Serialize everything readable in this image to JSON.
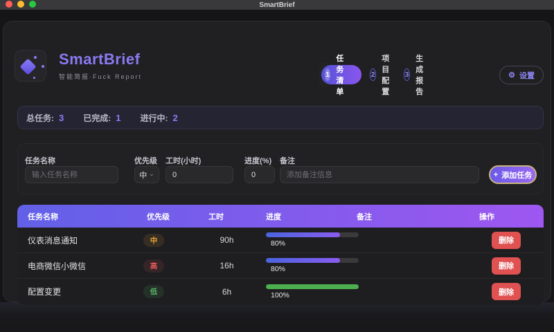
{
  "window": {
    "titlebar_title": "SmartBrief"
  },
  "header": {
    "app_title": "SmartBrief",
    "app_subtitle": "智能简报·Fuck Report",
    "settings_label": "设置"
  },
  "icons": {
    "gear": "⚙",
    "plus": "+",
    "chevron_down": "⌄"
  },
  "stepper": {
    "steps": [
      {
        "num": "1",
        "label": "任务清单",
        "active": true
      },
      {
        "num": "2",
        "label": "项目配置",
        "active": false
      },
      {
        "num": "3",
        "label": "生成报告",
        "active": false
      }
    ]
  },
  "stats": {
    "items": [
      {
        "label": "总任务:",
        "value": "3"
      },
      {
        "label": "已完成:",
        "value": "1"
      },
      {
        "label": "进行中:",
        "value": "2"
      }
    ]
  },
  "form": {
    "name": {
      "label": "任务名称",
      "placeholder": "输入任务名称",
      "value": ""
    },
    "priority": {
      "label": "优先级",
      "value": "中"
    },
    "hours": {
      "label": "工时(小时)",
      "value": "0"
    },
    "progress": {
      "label": "进度(%)",
      "value": "0"
    },
    "note": {
      "label": "备注",
      "placeholder": "添加备注信息",
      "value": ""
    },
    "add_label": "添加任务"
  },
  "table": {
    "headers": [
      "任务名称",
      "优先级",
      "工时",
      "进度",
      "备注",
      "操作"
    ],
    "rows": [
      {
        "name": "仪表消息通知",
        "priority": "中",
        "priority_level": "medium",
        "hours": "90h",
        "progress": 80,
        "progress_label": "80%",
        "note": "",
        "action": "删除"
      },
      {
        "name": "电商微信小微信",
        "priority": "高",
        "priority_level": "high",
        "hours": "16h",
        "progress": 80,
        "progress_label": "80%",
        "note": "",
        "action": "删除"
      },
      {
        "name": "配置变更",
        "priority": "低",
        "priority_level": "low",
        "hours": "6h",
        "progress": 100,
        "progress_label": "100%",
        "note": "",
        "action": "删除"
      }
    ]
  },
  "colors": {
    "accent_purple": "#8b7cf6",
    "header_gradient_start": "#6260e8",
    "header_gradient_end": "#9e57f0",
    "progress_gradient_start": "#4a64e0",
    "progress_gradient_end": "#8a5cf0",
    "progress_green": "#4caf50",
    "badge_medium": "#e8a33d",
    "badge_high": "#e25858",
    "badge_low": "#58b368",
    "delete_red": "#e05151",
    "add_button_ring": "#c9b57f"
  }
}
